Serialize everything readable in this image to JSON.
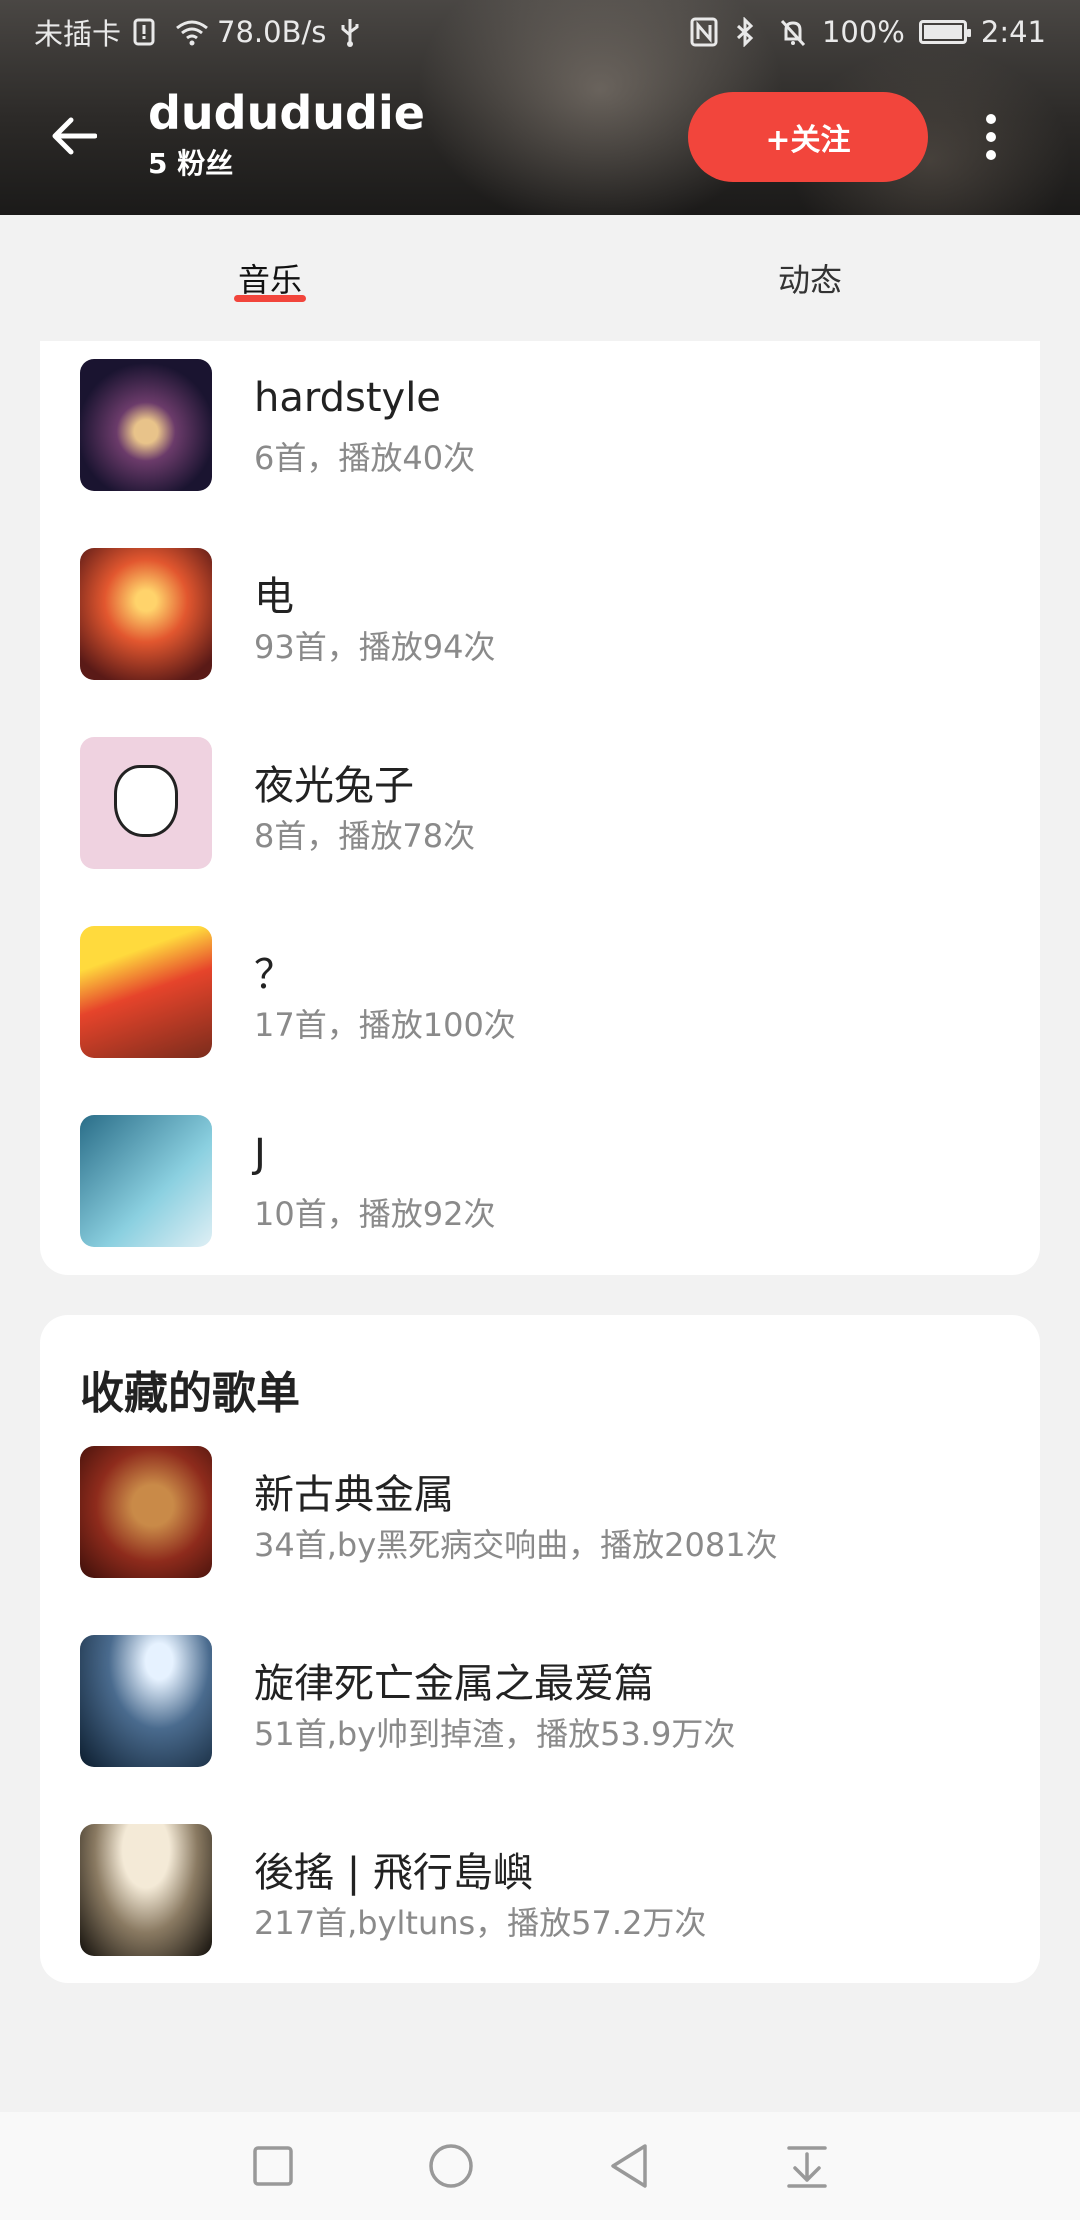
{
  "status_bar": {
    "carrier": "未插卡",
    "network_speed": "78.0B/s",
    "battery": "100%",
    "time": "2:41"
  },
  "header": {
    "username": "dudududie",
    "fans": "5 粉丝",
    "follow_label": "+关注"
  },
  "tabs": [
    {
      "label": "音乐",
      "active": true
    },
    {
      "label": "动态",
      "active": false
    }
  ],
  "playlists": [
    {
      "title": "hardstyle",
      "subtitle": "6首，播放40次"
    },
    {
      "title": "电",
      "subtitle": "93首，播放94次"
    },
    {
      "title": "夜光兔子",
      "subtitle": "8首，播放78次"
    },
    {
      "title": "？",
      "subtitle": "17首，播放100次"
    },
    {
      "title": "J",
      "subtitle": "10首，播放92次"
    }
  ],
  "favorites": {
    "section_title": "收藏的歌单",
    "items": [
      {
        "title": "新古典金属",
        "subtitle": "34首,by黑死病交响曲，播放2081次"
      },
      {
        "title": "旋律死亡金属之最爱篇",
        "subtitle": "51首,by帅到掉渣，播放53.9万次"
      },
      {
        "title": "後搖 | 飛行島嶼",
        "subtitle": "217首,byltuns，播放57.2万次"
      }
    ]
  },
  "colors": {
    "accent": "#f2453c",
    "page_bg": "#f2f2f2",
    "card_bg": "#ffffff",
    "secondary_text": "#8a8a8a"
  },
  "icons": {
    "back": "arrow-left-icon",
    "more": "more-vertical-icon",
    "nav": [
      "square-icon",
      "circle-icon",
      "triangle-back-icon",
      "download-tray-icon"
    ]
  }
}
